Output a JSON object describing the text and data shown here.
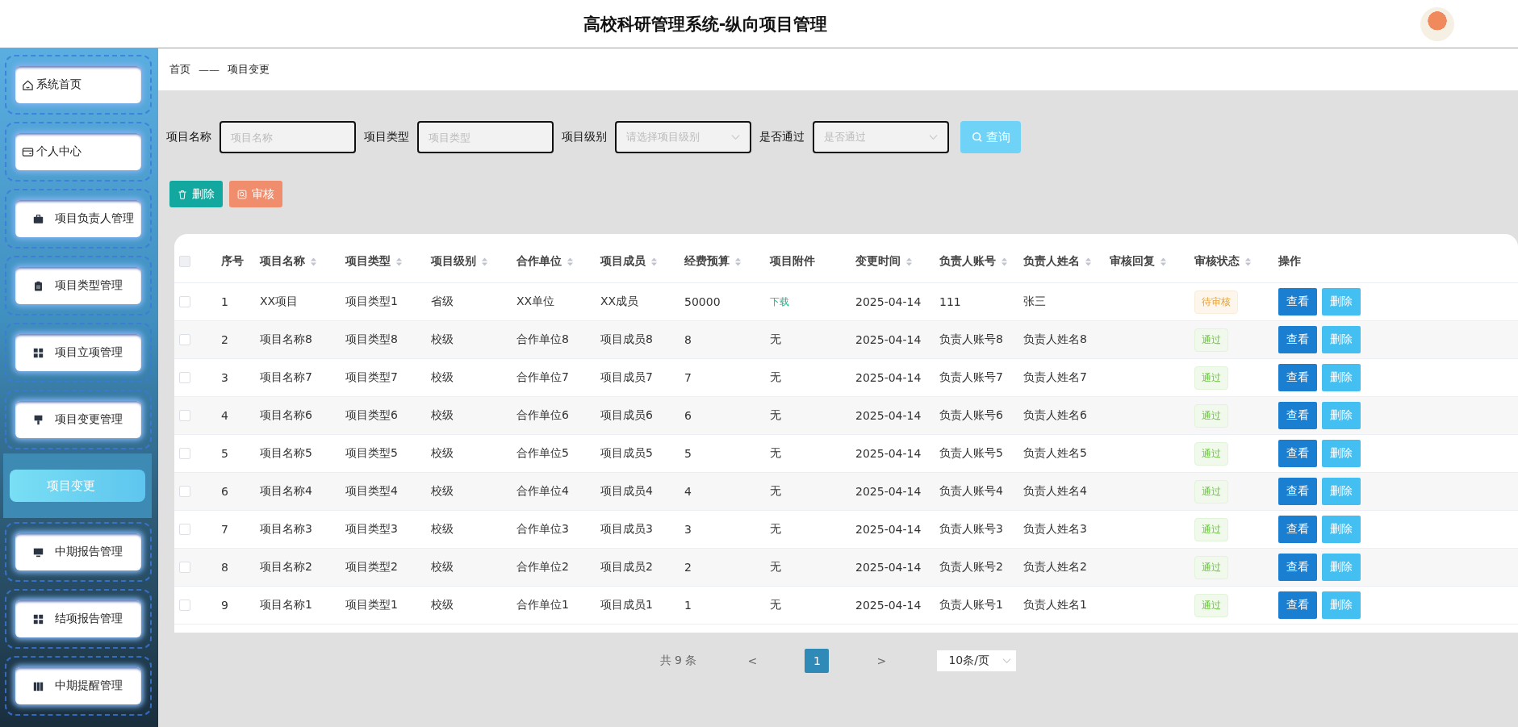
{
  "header": {
    "title": "高校科研管理系统-纵向项目管理"
  },
  "sidebar": {
    "items": [
      {
        "label": "系统首页",
        "kind": "home",
        "selected": false
      },
      {
        "label": "个人中心",
        "kind": "wallet",
        "selected": false
      },
      {
        "label": "项目负责人管理",
        "kind": "briefcase",
        "selected": false
      },
      {
        "label": "项目类型管理",
        "kind": "clipboard",
        "selected": false
      },
      {
        "label": "项目立项管理",
        "kind": "grid",
        "selected": false
      },
      {
        "label": "项目变更管理",
        "kind": "brush",
        "selected": false,
        "expanded": true,
        "children": [
          {
            "label": "项目变更",
            "selected": true
          }
        ]
      },
      {
        "label": "中期报告管理",
        "kind": "monitor",
        "selected": false
      },
      {
        "label": "结项报告管理",
        "kind": "grid",
        "selected": false
      },
      {
        "label": "中期提醒管理",
        "kind": "books",
        "selected": false
      }
    ]
  },
  "breadcrumb": {
    "items": [
      "首页",
      "项目变更"
    ],
    "separator": "——"
  },
  "filters": [
    {
      "label": "项目名称",
      "placeholder": "项目名称",
      "kind": "input"
    },
    {
      "label": "项目类型",
      "placeholder": "项目类型",
      "kind": "input"
    },
    {
      "label": "项目级别",
      "placeholder": "请选择项目级别",
      "kind": "select"
    },
    {
      "label": "是否通过",
      "placeholder": "是否通过",
      "kind": "select"
    }
  ],
  "search_button": "查询",
  "actions": [
    {
      "label": "删除",
      "kind": "delete"
    },
    {
      "label": "审核",
      "kind": "review"
    }
  ],
  "table": {
    "select_all": {
      "checked": false
    },
    "columns": [
      {
        "label": "序号",
        "sortable": false
      },
      {
        "label": "项目名称",
        "sortable": true
      },
      {
        "label": "项目类型",
        "sortable": true
      },
      {
        "label": "项目级别",
        "sortable": true
      },
      {
        "label": "合作单位",
        "sortable": true
      },
      {
        "label": "项目成员",
        "sortable": true
      },
      {
        "label": "经费预算",
        "sortable": true
      },
      {
        "label": "项目附件",
        "sortable": false
      },
      {
        "label": "变更时间",
        "sortable": true
      },
      {
        "label": "负责人账号",
        "sortable": true
      },
      {
        "label": "负责人姓名",
        "sortable": true
      },
      {
        "label": "审核回复",
        "sortable": true
      },
      {
        "label": "审核状态",
        "sortable": true
      },
      {
        "label": "操作",
        "sortable": false
      }
    ],
    "rows": [
      {
        "checked": false,
        "cells": [
          "1",
          "XX项目",
          "项目类型1",
          "省级",
          "XX单位",
          "XX成员",
          "50000"
        ],
        "attachment": {
          "text": "下载",
          "link": true
        },
        "time": "2025-04-14",
        "account": "111",
        "owner": "张三",
        "status": {
          "text": "待审核",
          "kind": "pending"
        },
        "actions": [
          "查看",
          "删除"
        ]
      },
      {
        "checked": false,
        "cells": [
          "2",
          "项目名称8",
          "项目类型8",
          "校级",
          "合作单位8",
          "项目成员8",
          "8"
        ],
        "attachment": {
          "text": "无",
          "link": false
        },
        "time": "2025-04-14",
        "account": "负责人账号8",
        "owner": "负责人姓名8",
        "status": {
          "text": "通过",
          "kind": "passed"
        },
        "actions": [
          "查看",
          "删除"
        ]
      },
      {
        "checked": false,
        "cells": [
          "3",
          "项目名称7",
          "项目类型7",
          "校级",
          "合作单位7",
          "项目成员7",
          "7"
        ],
        "attachment": {
          "text": "无",
          "link": false
        },
        "time": "2025-04-14",
        "account": "负责人账号7",
        "owner": "负责人姓名7",
        "status": {
          "text": "通过",
          "kind": "passed"
        },
        "actions": [
          "查看",
          "删除"
        ]
      },
      {
        "checked": false,
        "cells": [
          "4",
          "项目名称6",
          "项目类型6",
          "校级",
          "合作单位6",
          "项目成员6",
          "6"
        ],
        "attachment": {
          "text": "无",
          "link": false
        },
        "time": "2025-04-14",
        "account": "负责人账号6",
        "owner": "负责人姓名6",
        "status": {
          "text": "通过",
          "kind": "passed"
        },
        "actions": [
          "查看",
          "删除"
        ]
      },
      {
        "checked": false,
        "cells": [
          "5",
          "项目名称5",
          "项目类型5",
          "校级",
          "合作单位5",
          "项目成员5",
          "5"
        ],
        "attachment": {
          "text": "无",
          "link": false
        },
        "time": "2025-04-14",
        "account": "负责人账号5",
        "owner": "负责人姓名5",
        "status": {
          "text": "通过",
          "kind": "passed"
        },
        "actions": [
          "查看",
          "删除"
        ]
      },
      {
        "checked": false,
        "cells": [
          "6",
          "项目名称4",
          "项目类型4",
          "校级",
          "合作单位4",
          "项目成员4",
          "4"
        ],
        "attachment": {
          "text": "无",
          "link": false
        },
        "time": "2025-04-14",
        "account": "负责人账号4",
        "owner": "负责人姓名4",
        "status": {
          "text": "通过",
          "kind": "passed"
        },
        "actions": [
          "查看",
          "删除"
        ]
      },
      {
        "checked": false,
        "cells": [
          "7",
          "项目名称3",
          "项目类型3",
          "校级",
          "合作单位3",
          "项目成员3",
          "3"
        ],
        "attachment": {
          "text": "无",
          "link": false
        },
        "time": "2025-04-14",
        "account": "负责人账号3",
        "owner": "负责人姓名3",
        "status": {
          "text": "通过",
          "kind": "passed"
        },
        "actions": [
          "查看",
          "删除"
        ]
      },
      {
        "checked": false,
        "cells": [
          "8",
          "项目名称2",
          "项目类型2",
          "校级",
          "合作单位2",
          "项目成员2",
          "2"
        ],
        "attachment": {
          "text": "无",
          "link": false
        },
        "time": "2025-04-14",
        "account": "负责人账号2",
        "owner": "负责人姓名2",
        "status": {
          "text": "通过",
          "kind": "passed"
        },
        "actions": [
          "查看",
          "删除"
        ]
      },
      {
        "checked": false,
        "cells": [
          "9",
          "项目名称1",
          "项目类型1",
          "校级",
          "合作单位1",
          "项目成员1",
          "1"
        ],
        "attachment": {
          "text": "无",
          "link": false
        },
        "time": "2025-04-14",
        "account": "负责人账号1",
        "owner": "负责人姓名1",
        "status": {
          "text": "通过",
          "kind": "passed"
        },
        "actions": [
          "查看",
          "删除"
        ]
      }
    ]
  },
  "pagination": {
    "total": "共 9 条",
    "prev": "<",
    "pages": [
      {
        "label": "1",
        "selected": true
      }
    ],
    "next": ">",
    "page_size": "10条/页"
  }
}
